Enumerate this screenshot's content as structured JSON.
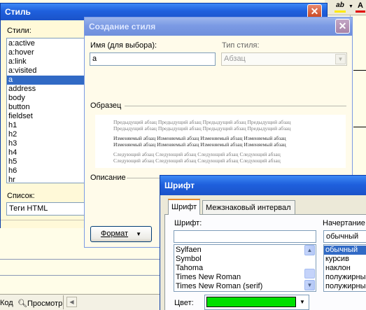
{
  "toolbar": {
    "underline_icon": "ab-underline-icon",
    "font_color_icon": "font-color-icon"
  },
  "style_window": {
    "title": "Стиль",
    "styles_label": "Стили:",
    "styles": [
      "a:active",
      "a:hover",
      "a:link",
      "a:visited",
      "a",
      "address",
      "body",
      "button",
      "fieldset",
      "h1",
      "h2",
      "h3",
      "h4",
      "h5",
      "h6",
      "hr"
    ],
    "selected_style": "a",
    "list_label": "Список:",
    "list_value": "Теги HTML"
  },
  "create_style_dialog": {
    "title": "Создание стиля",
    "name_label": "Имя (для выбора):",
    "name_value": "a",
    "type_label": "Тип стиля:",
    "type_value": "Абзац",
    "sample_label": "Образец",
    "sample_prev": "Предыдущий абзац Предыдущий абзац Предыдущий абзац Предыдущий абзац",
    "sample_current": "Изменяемый абзац Изменяемый абзац Изменяемый абзац Изменяемый абзац",
    "sample_next": "Следующий абзац Следующий абзац Следующий абзац Следующий абзац",
    "description_label": "Описание",
    "format_button": "Формат"
  },
  "font_dialog": {
    "title": "Шрифт",
    "tabs": [
      "Шрифт",
      "Межзнаковый интервал"
    ],
    "font_label": "Шрифт:",
    "font_value": "",
    "fonts": [
      "Sylfaen",
      "Symbol",
      "Tahoma",
      "Times New Roman",
      "Times New Roman (serif)"
    ],
    "style_label": "Начертание",
    "style_value": "обычный",
    "styles": [
      "обычный",
      "курсив",
      "наклон",
      "полужирный",
      "полужирный"
    ],
    "selected_style": "обычный",
    "color_label": "Цвет:",
    "color_value": "#00e000"
  },
  "statusbar": {
    "code_tab": "Код",
    "preview_tab": "Просмотр"
  },
  "colors": {
    "accent": "#316ac5",
    "title_active": "#1f60dd",
    "title_inactive": "#7b9ae4",
    "swatch": "#00e000"
  }
}
